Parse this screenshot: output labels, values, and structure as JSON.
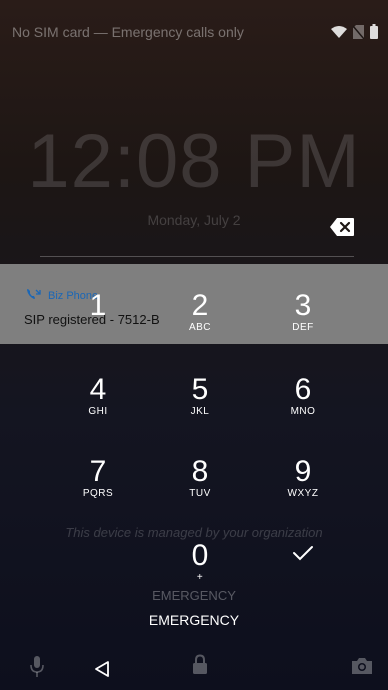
{
  "status": {
    "text": "No SIM card — Emergency calls only",
    "icons": [
      "wifi-icon",
      "no-sim-icon",
      "battery-icon"
    ]
  },
  "lockscreen": {
    "time": "12:08 PM",
    "date": "Monday, July 2"
  },
  "notification": {
    "app": "Biz Phone",
    "text": "SIP registered - 7512-B"
  },
  "keypad": {
    "keys": [
      {
        "num": "1",
        "letters": ""
      },
      {
        "num": "2",
        "letters": "ABC"
      },
      {
        "num": "3",
        "letters": "DEF"
      },
      {
        "num": "4",
        "letters": "GHI"
      },
      {
        "num": "5",
        "letters": "JKL"
      },
      {
        "num": "6",
        "letters": "MNO"
      },
      {
        "num": "7",
        "letters": "PQRS"
      },
      {
        "num": "8",
        "letters": "TUV"
      },
      {
        "num": "9",
        "letters": "WXYZ"
      },
      {
        "num": "0",
        "letters": "+"
      }
    ],
    "confirm_icon": "check-icon",
    "backspace_icon": "backspace-icon"
  },
  "managed_text": "This device is managed by your organization",
  "emergency": {
    "faint_label": "EMERGENCY",
    "button_label": "EMERGENCY"
  },
  "navbar": {
    "icons": [
      "mic-icon",
      "back-icon",
      "lock-icon",
      "camera-icon"
    ]
  },
  "colors": {
    "notification_bg": "#7f7f7f",
    "notification_app": "#1b67b6"
  }
}
